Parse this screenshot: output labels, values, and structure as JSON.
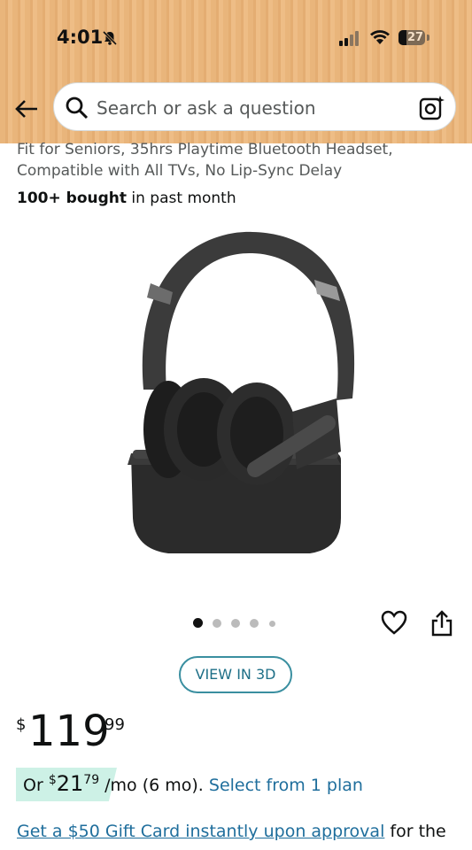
{
  "status_bar": {
    "time": "4:01",
    "battery": "27"
  },
  "search": {
    "placeholder": "Search or ask a question"
  },
  "product": {
    "title_line1": "Fit for Seniors, 35hrs Playtime Bluetooth Headset,",
    "title_line2": "Compatible with All TVs, No Lip-Sync Delay",
    "bought_bold": "100+ bought",
    "bought_rest": " in past month"
  },
  "gallery": {
    "dot_count": 5,
    "active_dot": 0
  },
  "view3d_label": "VIEW IN 3D",
  "price": {
    "symbol": "$",
    "whole": "119",
    "fraction": "99"
  },
  "monthly": {
    "prefix": "Or ",
    "symbol": "$",
    "whole": "21",
    "fraction": "79",
    "suffix": " /mo (6 mo). ",
    "link": "Select from 1 plan"
  },
  "giftcard": {
    "link": "Get a $50 Gift Card instantly upon approval",
    "rest": " for the"
  },
  "colors": {
    "header_bg": "#e9b57b",
    "link": "#1f6e9c",
    "accent_outline": "#3a8fa0",
    "monthly_highlight": "#cdf1e6"
  }
}
